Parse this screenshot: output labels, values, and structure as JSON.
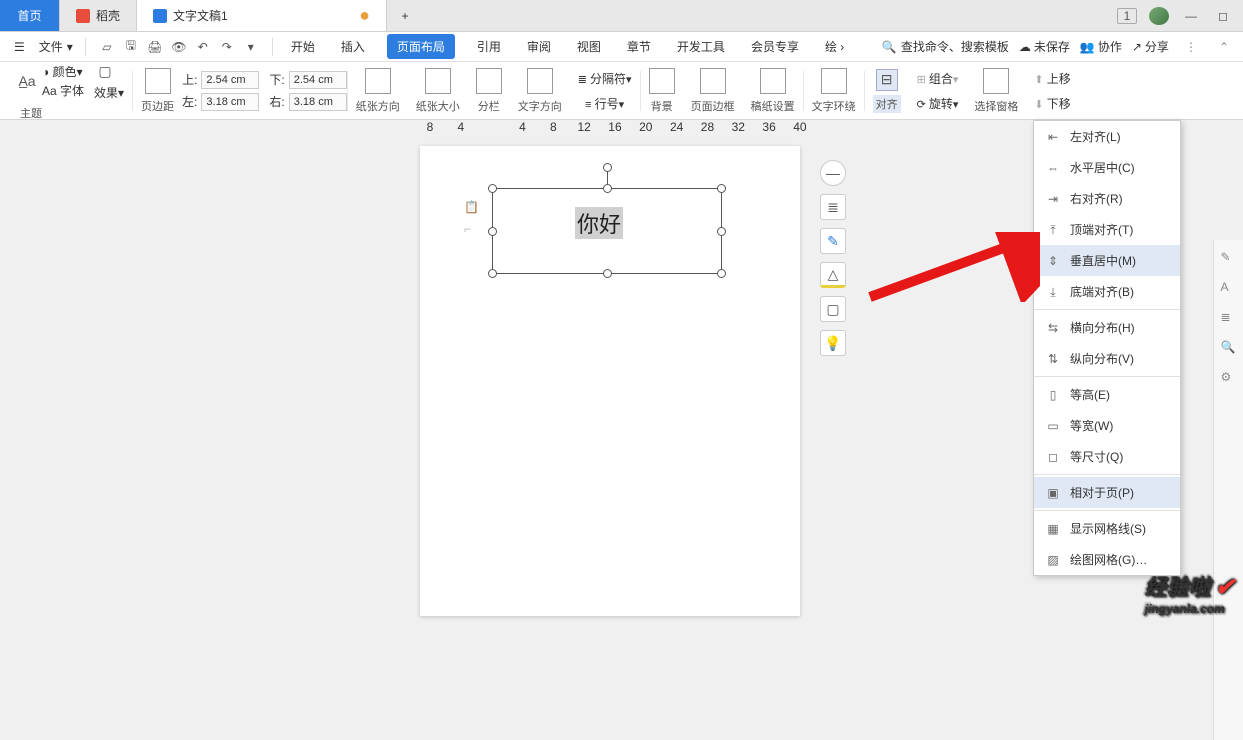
{
  "tabs": {
    "home": "首页",
    "docer": "稻壳",
    "doc": "文字文稿1",
    "dot": "●",
    "plus": "+",
    "window_num": "1"
  },
  "menubar": {
    "file": "文件",
    "menus": [
      "开始",
      "插入",
      "页面布局",
      "引用",
      "审阅",
      "视图",
      "章节",
      "开发工具",
      "会员专享",
      "绘"
    ],
    "search_placeholder": "查找命令、搜索模板",
    "unsaved": "未保存",
    "collab": "协作",
    "share": "分享"
  },
  "ribbon": {
    "theme": "主题",
    "color": "颜色",
    "font": "Aa 字体",
    "effect": "效果",
    "margin": "页边距",
    "mtop": "上:",
    "mtop_v": "2.54 cm",
    "mbottom": "下:",
    "mbottom_v": "2.54 cm",
    "mleft": "左:",
    "mleft_v": "3.18 cm",
    "mright": "右:",
    "mright_v": "3.18 cm",
    "orient": "纸张方向",
    "size": "纸张大小",
    "columns": "分栏",
    "textdir": "文字方向",
    "breaks": "分隔符",
    "lineno": "行号",
    "bg": "背景",
    "border": "页面边框",
    "paper": "稿纸设置",
    "wrap": "文字环绕",
    "align": "对齐",
    "rotate": "旋转",
    "group": "组合",
    "pane": "选择窗格",
    "moveup": "上移",
    "movedown": "下移"
  },
  "ruler": [
    "8",
    "4",
    "",
    "4",
    "8",
    "12",
    "16",
    "20",
    "24",
    "28",
    "32",
    "36",
    "40"
  ],
  "textbox_text": "你好",
  "dropdown": {
    "items": [
      {
        "label": "左对齐(L)"
      },
      {
        "label": "水平居中(C)"
      },
      {
        "label": "右对齐(R)"
      },
      {
        "label": "顶端对齐(T)"
      },
      {
        "label": "垂直居中(M)",
        "selected": true
      },
      {
        "label": "底端对齐(B)"
      },
      {
        "label": "横向分布(H)"
      },
      {
        "label": "纵向分布(V)"
      },
      {
        "label": "等高(E)",
        "disabled": true
      },
      {
        "label": "等宽(W)",
        "disabled": true
      },
      {
        "label": "等尺寸(Q)",
        "disabled": true
      },
      {
        "label": "相对于页(P)"
      },
      {
        "label": "显示网格线(S)"
      },
      {
        "label": "绘图网格(G)…"
      }
    ]
  },
  "watermark": {
    "brand": "经验啦",
    "domain": "jingyanla.com"
  }
}
